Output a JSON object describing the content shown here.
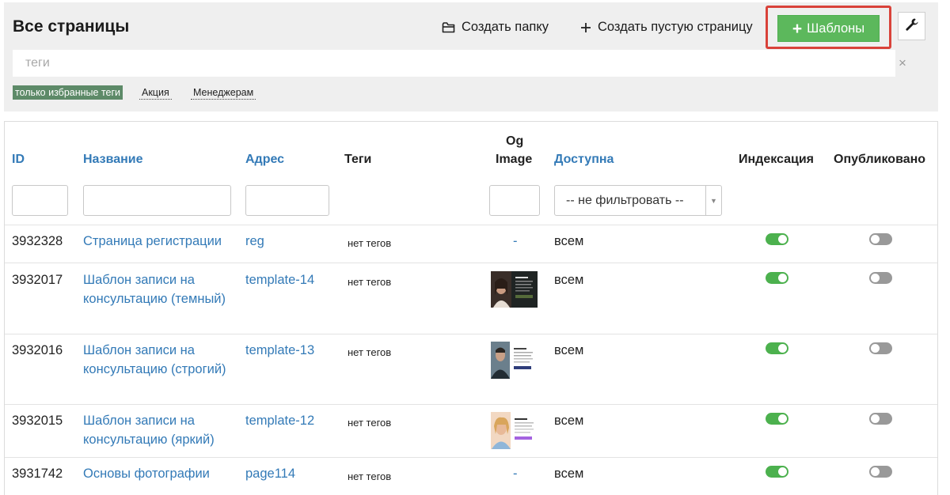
{
  "header": {
    "title": "Все страницы",
    "create_folder": "Создать папку",
    "create_empty_page": "Создать пустую страницу",
    "templates_plus": "+",
    "templates_label": "Шаблоны"
  },
  "tags_filter": {
    "placeholder": "теги",
    "clear_symbol": "×",
    "chips": [
      "только избранные теги",
      "Акция",
      "Менеджерам"
    ]
  },
  "table": {
    "columns": {
      "id": "ID",
      "name": "Название",
      "address": "Адрес",
      "tags": "Теги",
      "og_image_line1": "Og",
      "og_image_line2": "Image",
      "available": "Доступна",
      "indexing": "Индексация",
      "published": "Опубликовано"
    },
    "available_filter_value": "-- не фильтровать --",
    "rows": [
      {
        "id": "3932328",
        "name": "Страница регистрации",
        "address": "reg",
        "tags": "нет тегов",
        "og_image": "-",
        "available": "всем",
        "indexing": true,
        "published": false
      },
      {
        "id": "3932017",
        "name": "Шаблон записи на консультацию (темный)",
        "address": "template-14",
        "tags": "нет тегов",
        "og_image": "thumbnail-dark",
        "available": "всем",
        "indexing": true,
        "published": false
      },
      {
        "id": "3932016",
        "name": "Шаблон записи на консультацию (строгий)",
        "address": "template-13",
        "tags": "нет тегов",
        "og_image": "thumbnail-strict",
        "available": "всем",
        "indexing": true,
        "published": false
      },
      {
        "id": "3932015",
        "name": "Шаблон записи на консультацию (яркий)",
        "address": "template-12",
        "tags": "нет тегов",
        "og_image": "thumbnail-bright",
        "available": "всем",
        "indexing": true,
        "published": false
      },
      {
        "id": "3931742",
        "name": "Основы фотографии",
        "address": "page114",
        "tags": "нет тегов",
        "og_image": "-",
        "available": "всем",
        "indexing": true,
        "published": false
      }
    ]
  },
  "colors": {
    "accent_link": "#337ab7",
    "templates_button": "#5cb85c",
    "highlight_border": "#d9423a",
    "toggle_on": "#4cb14e",
    "toggle_off": "#999999",
    "active_tag": "#5d8a68"
  }
}
